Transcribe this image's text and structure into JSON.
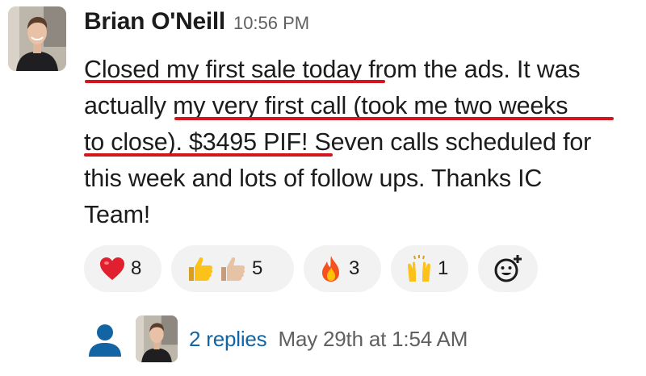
{
  "message": {
    "sender_name": "Brian O'Neill",
    "timestamp": "10:56 PM",
    "lines": [
      "Closed my first sale today from the ads. It was",
      "actually my very first call (took me two weeks",
      "to close). $3495 PIF! Seven calls scheduled for",
      "this week and lots of follow ups. Thanks IC",
      "Team!"
    ],
    "highlight_color": "#d2151f"
  },
  "reactions": [
    {
      "icon": "red-heart-icon",
      "count": "8"
    },
    {
      "icon": "thumbs-up-icon",
      "count": "5"
    },
    {
      "icon": "fire-icon",
      "count": "3"
    },
    {
      "icon": "raising-hands-icon",
      "count": "1"
    }
  ],
  "add_reaction_icon": "add-reaction-icon",
  "thread": {
    "replies_label": "2 replies",
    "last_reply": "May 29th at 1:54 AM",
    "link_color": "#1264a3"
  }
}
